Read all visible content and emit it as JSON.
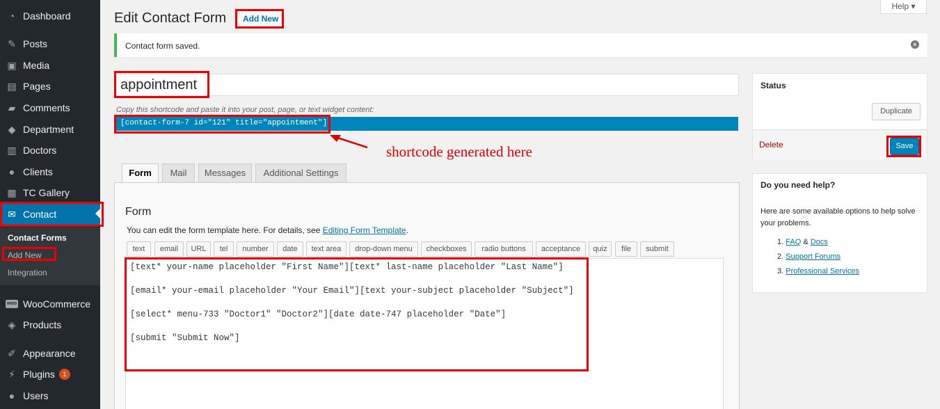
{
  "sidebar": {
    "items": [
      {
        "label": "Dashboard",
        "icon": "dashboard-icon"
      },
      {
        "label": "Posts",
        "icon": "pin-icon"
      },
      {
        "label": "Media",
        "icon": "media-icon"
      },
      {
        "label": "Pages",
        "icon": "pages-icon"
      },
      {
        "label": "Comments",
        "icon": "comments-icon"
      },
      {
        "label": "Department",
        "icon": "tag-icon"
      },
      {
        "label": "Doctors",
        "icon": "building-icon"
      },
      {
        "label": "Clients",
        "icon": "user-icon"
      },
      {
        "label": "TC Gallery",
        "icon": "gallery-icon"
      },
      {
        "label": "Contact",
        "icon": "envelope-icon"
      },
      {
        "label": "WooCommerce",
        "icon": "woocommerce-icon",
        "icon_text": "woo"
      },
      {
        "label": "Products",
        "icon": "box-icon"
      },
      {
        "label": "Appearance",
        "icon": "brush-icon"
      },
      {
        "label": "Plugins",
        "icon": "plugin-icon",
        "badge": "1"
      },
      {
        "label": "Users",
        "icon": "users-icon"
      }
    ],
    "submenu": [
      "Contact Forms",
      "Add New",
      "Integration"
    ]
  },
  "header": {
    "title": "Edit Contact Form",
    "add_new": "Add New",
    "help": "Help"
  },
  "notice": {
    "text": "Contact form saved."
  },
  "form": {
    "title_value": "appointment",
    "shortcode_hint": "Copy this shortcode and paste it into your post, page, or text widget content:",
    "shortcode": "[contact-form-7 id=\"121\" title=\"appointment\"]",
    "annotation": "shortcode generated here"
  },
  "tabs": [
    "Form",
    "Mail",
    "Messages",
    "Additional Settings"
  ],
  "panel": {
    "title": "Form",
    "desc_prefix": "You can edit the form template here. For details, see ",
    "desc_link": "Editing Form Template",
    "desc_suffix": ".",
    "tag_buttons": [
      "text",
      "email",
      "URL",
      "tel",
      "number",
      "date",
      "text area",
      "drop-down menu",
      "checkboxes",
      "radio buttons",
      "acceptance",
      "quiz",
      "file",
      "submit"
    ],
    "code_lines": [
      "[text* your-name placeholder \"First Name\"][text* last-name placeholder \"Last Name\"]",
      "[email* your-email placeholder \"Your Email\"][text your-subject placeholder \"Subject\"]",
      "[select* menu-733 \"Doctor1\" \"Doctor2\"][date date-747 placeholder \"Date\"]",
      "[submit \"Submit Now\"]"
    ]
  },
  "status_box": {
    "title": "Status",
    "duplicate": "Duplicate",
    "delete": "Delete",
    "save": "Save"
  },
  "help_box": {
    "title": "Do you need help?",
    "text": "Here are some available options to help solve your problems.",
    "item1_num": "1.",
    "item1_link_a": "FAQ",
    "item1_amp": " & ",
    "item1_link_b": "Docs",
    "item2_num": "2.",
    "item2_link": "Support Forums",
    "item3_num": "3.",
    "item3_link": "Professional Services"
  },
  "colors": {
    "accent": "#0073aa",
    "highlight": "#ee0000",
    "sidebar": "#23282d",
    "success": "#46b450"
  }
}
